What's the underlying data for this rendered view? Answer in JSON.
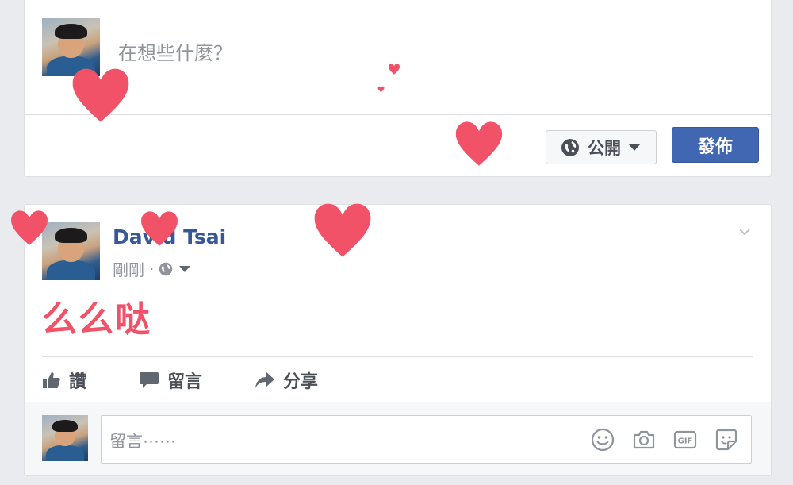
{
  "composer": {
    "placeholder": "在想些什麼？",
    "privacy_label": "公開",
    "post_button_label": "發佈"
  },
  "post": {
    "author_name": "David Tsai",
    "timestamp": "剛剛",
    "separator": "·",
    "text": "么么哒",
    "text_color": "#f25268",
    "actions": {
      "like_label": "讚",
      "comment_label": "留言",
      "share_label": "分享"
    },
    "comment_placeholder": "留言⋯⋯",
    "comment_tools": [
      "emoji-icon",
      "camera-icon",
      "gif-icon",
      "sticker-icon"
    ]
  },
  "colors": {
    "accent": "#4267b2",
    "link": "#365899",
    "heart": "#f25268",
    "background": "#e9ebee"
  },
  "icons": {
    "gif_text": "GIF"
  }
}
